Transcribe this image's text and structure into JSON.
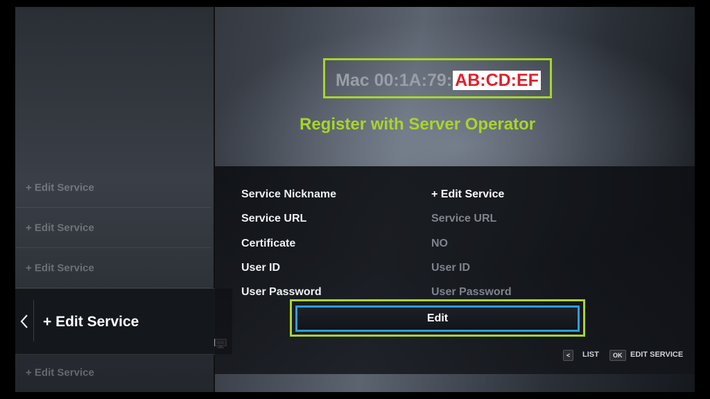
{
  "mac": {
    "prefix": "Mac 00:1A:79:",
    "suffix": "AB:CD:EF"
  },
  "register_text": "Register with Server Operator",
  "sidebar": {
    "items": [
      {
        "label": "+ Edit Service"
      },
      {
        "label": "+ Edit Service"
      },
      {
        "label": "+ Edit Service"
      },
      {
        "label": "+ Edit Service"
      }
    ],
    "selected": {
      "label": "+ Edit Service",
      "back_icon": "chevron-left-icon",
      "type_icon": "monitor-icon"
    }
  },
  "form": {
    "fields": [
      {
        "label": "Service Nickname",
        "value": "+ Edit Service"
      },
      {
        "label": "Service URL",
        "value": "Service URL"
      },
      {
        "label": "Certificate",
        "value": "NO"
      },
      {
        "label": "User ID",
        "value": "User ID"
      },
      {
        "label": "User Password",
        "value": "User Password"
      }
    ],
    "edit_button": "Edit"
  },
  "hints": [
    {
      "key": "<",
      "label": "LIST"
    },
    {
      "key": "OK",
      "label": "EDIT SERVICE"
    }
  ],
  "colors": {
    "highlight_green": "#a8d52b",
    "focus_blue": "#2e9fd8",
    "mac_red": "#e0202a"
  }
}
